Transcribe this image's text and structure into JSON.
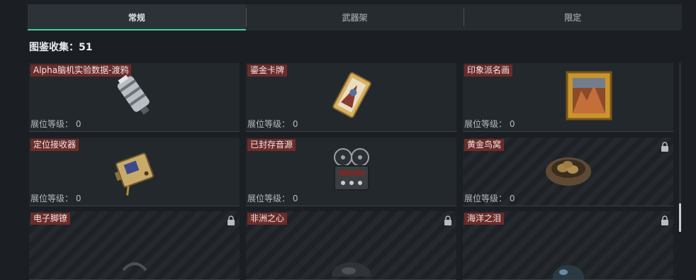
{
  "tabs": [
    {
      "label": "常规",
      "active": true
    },
    {
      "label": "武器架",
      "active": false
    },
    {
      "label": "限定",
      "active": false
    }
  ],
  "collection": {
    "label": "图鉴收集：51"
  },
  "level_label": "展位等级：",
  "items": [
    {
      "name": "Alpha脑机实验数据-渡鸦",
      "level": "0",
      "locked": false,
      "icon": "data-cylinder-icon"
    },
    {
      "name": "鎏金卡牌",
      "level": "0",
      "locked": false,
      "icon": "gilded-card-icon"
    },
    {
      "name": "印象派名画",
      "level": "0",
      "locked": false,
      "icon": "framed-painting-icon"
    },
    {
      "name": "定位接收器",
      "level": "0",
      "locked": false,
      "icon": "receiver-device-icon"
    },
    {
      "name": "已封存音源",
      "level": "0",
      "locked": false,
      "icon": "reel-recorder-icon"
    },
    {
      "name": "黄金鸟窝",
      "level": "0",
      "locked": true,
      "icon": "golden-nest-icon"
    },
    {
      "name": "电子脚镣",
      "level": "",
      "locked": true,
      "icon": "ankle-monitor-icon"
    },
    {
      "name": "非洲之心",
      "level": "",
      "locked": true,
      "icon": "gem-icon"
    },
    {
      "name": "海洋之泪",
      "level": "",
      "locked": true,
      "icon": "pearl-icon"
    }
  ],
  "colors": {
    "accent": "#3fd19a",
    "name_tag": "#6b2c2b"
  }
}
